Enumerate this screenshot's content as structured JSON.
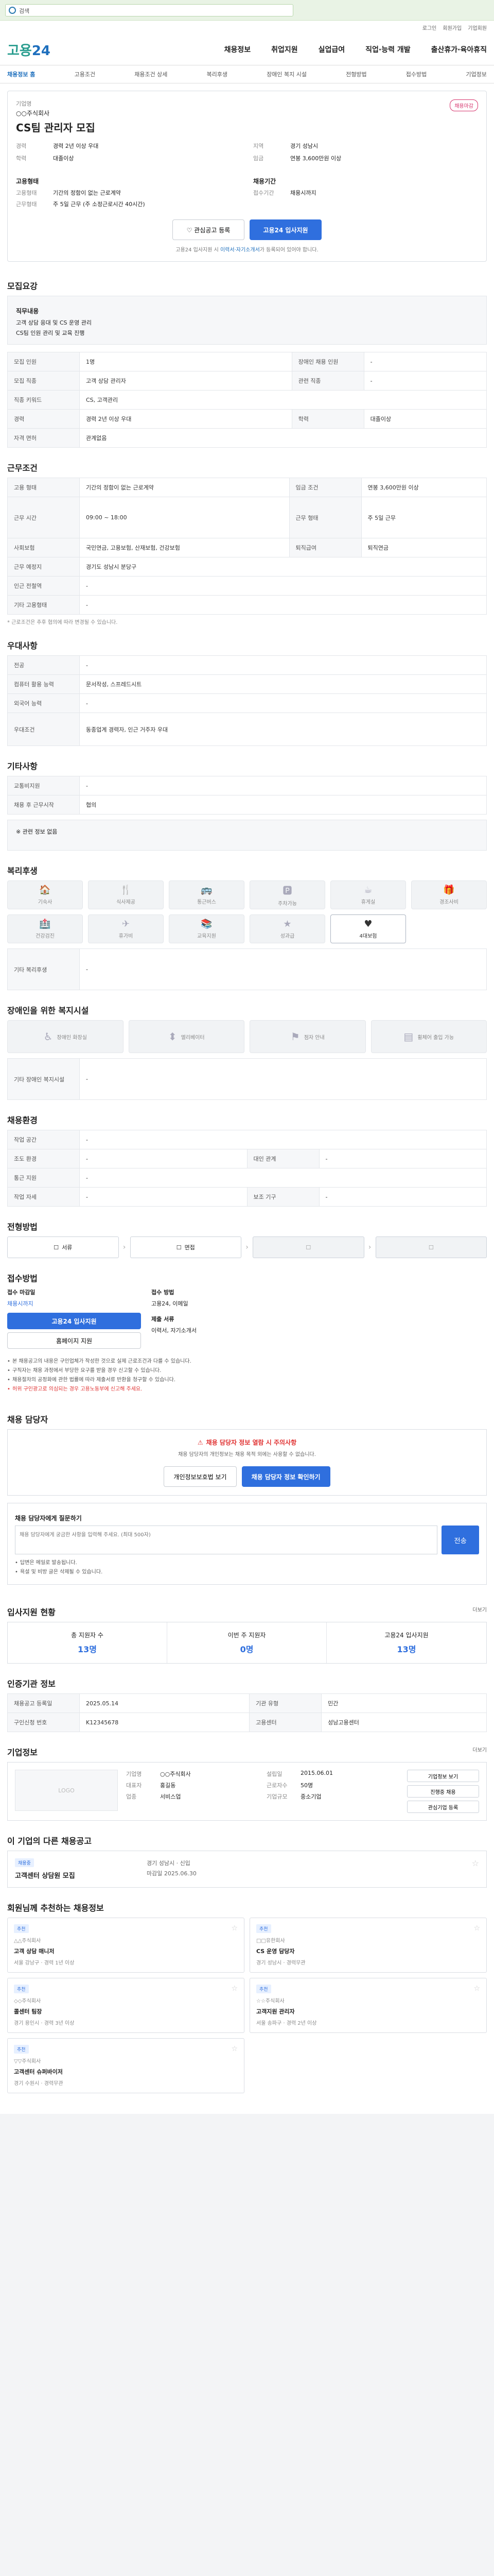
{
  "topbar": {
    "search_label": "검색"
  },
  "util": {
    "login": "로그인",
    "join": "회원가입",
    "corp": "기업회원"
  },
  "header": {
    "logo_a": "고용",
    "logo_b": "24"
  },
  "gnb": [
    {
      "label": "채용정보"
    },
    {
      "label": "취업지원"
    },
    {
      "label": "실업급여"
    },
    {
      "label": "직업·능력 개발"
    },
    {
      "label": "출산휴가·육아휴직"
    }
  ],
  "lnb": [
    "채용정보 홈",
    "고용조건",
    "채용조건 상세",
    "복리후생",
    "장애인 복지 시설",
    "전형방법",
    "접수방법",
    "기업정보"
  ],
  "job": {
    "company_label": "기업명",
    "company": "○○주식회사",
    "title": "CS팀 관리자 모집",
    "badge": "채용마감",
    "info": [
      {
        "k": "경력",
        "v": "경력 2년 이상 우대"
      },
      {
        "k": "지역",
        "v": "경기 성남시"
      },
      {
        "k": "학력",
        "v": "대졸이상"
      },
      {
        "k": "임금",
        "v": "연봉 3,600만원 이상"
      }
    ],
    "cond_title": "고용형태",
    "cond": [
      {
        "k": "고용형태",
        "v": "기간의 정함이 없는 근로계약"
      },
      {
        "k": "근무형태",
        "v": "주 5일 근무 (주 소정근로시간 40시간)"
      }
    ],
    "period_title": "채용기간",
    "period": [
      {
        "k": "접수기간",
        "v": "채용시까지"
      }
    ],
    "btn_save": "관심공고 등록",
    "btn_apply": "고용24 입사지원",
    "note_a": "고용24 입사지원 시 ",
    "note_b": "이력서·자기소개서",
    "note_c": "가 등록되어 있어야 합니다."
  },
  "s1": {
    "title": "모집요강",
    "duty_title": "직무내용",
    "duty": [
      "고객 상담 응대 및 CS 운영 관리",
      "CS팀 인원 관리 및 교육 진행"
    ],
    "rows": [
      {
        "k": "모집 인원",
        "v": "1명",
        "k2": "장애인 채용 인원",
        "v2": "-"
      },
      {
        "k": "모집 직종",
        "v": "고객 상담 관리자",
        "k2": "관련 직종",
        "v2": "-"
      },
      {
        "k": "직종 키워드",
        "v": "CS, 고객관리",
        "k2": "",
        "v2": ""
      },
      {
        "k": "경력",
        "v": "경력 2년 이상 우대",
        "k2": "학력",
        "v2": "대졸이상"
      },
      {
        "k": "자격 면허",
        "v": "관계없음",
        "k2": "",
        "v2": ""
      }
    ]
  },
  "s2": {
    "title": "근무조건",
    "rows": [
      {
        "k": "고용 형태",
        "v": "기간의 정함이 없는 근로계약",
        "k2": "임금 조건",
        "v2": "연봉 3,600만원 이상"
      },
      {
        "k": "근무 시간",
        "v": "09:00 ~ 18:00",
        "k2": "근무 형태",
        "v2": "주 5일 근무"
      },
      {
        "k": "사회보험",
        "v": "국민연금, 고용보험, 산재보험, 건강보험",
        "k2": "퇴직급여",
        "v2": "퇴직연금"
      },
      {
        "k": "근무 예정지",
        "v": "경기도 성남시 분당구",
        "k2": "",
        "v2": ""
      },
      {
        "k": "인근 전철역",
        "v": "-",
        "k2": "",
        "v2": ""
      },
      {
        "k": "기타 고용형태",
        "v": "-",
        "k2": "",
        "v2": ""
      }
    ],
    "note": "* 근로조건은 추후 협의에 따라 변경될 수 있습니다."
  },
  "s3": {
    "title": "우대사항",
    "rows": [
      {
        "k": "전공",
        "v": "-"
      },
      {
        "k": "컴퓨터 활용 능력",
        "v": "문서작성, 스프레드시트"
      },
      {
        "k": "외국어 능력",
        "v": "-"
      },
      {
        "k": "우대조건",
        "v": "동종업계 경력자, 인근 거주자 우대"
      }
    ]
  },
  "s4": {
    "title": "기타사항",
    "rows": [
      {
        "k": "교통비지원",
        "v": "-"
      },
      {
        "k": "채용 후 근무시작",
        "v": "협의"
      }
    ],
    "box": "※ 관련 정보 없음"
  },
  "s5": {
    "title": "복리후생",
    "items": [
      {
        "icon": "🏠",
        "label": "기숙사",
        "on": false
      },
      {
        "icon": "🍴",
        "label": "식사제공",
        "on": false
      },
      {
        "icon": "🚌",
        "label": "통근버스",
        "on": false
      },
      {
        "icon": "🅿",
        "label": "주차가능",
        "on": false
      },
      {
        "icon": "☕",
        "label": "휴게실",
        "on": false
      },
      {
        "icon": "🎁",
        "label": "경조사비",
        "on": false
      },
      {
        "icon": "🏥",
        "label": "건강검진",
        "on": false
      },
      {
        "icon": "✈",
        "label": "휴가비",
        "on": false
      },
      {
        "icon": "📚",
        "label": "교육지원",
        "on": false
      },
      {
        "icon": "★",
        "label": "성과급",
        "on": false
      },
      {
        "icon": "♥",
        "label": "4대보험",
        "on": true
      }
    ],
    "etc_label": "기타 복리후생",
    "etc": "-"
  },
  "s6": {
    "title": "장애인을 위한 복지시설",
    "items": [
      {
        "icon": "♿",
        "label": "장애인 화장실"
      },
      {
        "icon": "⬍",
        "label": "엘리베이터"
      },
      {
        "icon": "⚑",
        "label": "점자 안내"
      },
      {
        "icon": "▤",
        "label": "휠체어 출입 가능"
      }
    ],
    "etc_label": "기타 장애인 복지시설",
    "etc": "-"
  },
  "s7": {
    "title": "채용환경",
    "rows": [
      {
        "k": "작업 공간",
        "v": "-",
        "k2": "",
        "v2": ""
      },
      {
        "k": "조도 환경",
        "v": "-",
        "k2": "대인 관계",
        "v2": "-"
      },
      {
        "k": "통근 지원",
        "v": "-",
        "k2": "",
        "v2": ""
      },
      {
        "k": "작업 자세",
        "v": "-",
        "k2": "보조 기구",
        "v2": "-"
      }
    ]
  },
  "s8": {
    "title": "전형방법",
    "steps": [
      {
        "icon": "☐",
        "label": "서류",
        "off": false
      },
      {
        "icon": "☐",
        "label": "면접",
        "off": false
      },
      {
        "icon": "☐",
        "label": "",
        "off": true
      },
      {
        "icon": "☐",
        "label": "",
        "off": true
      }
    ]
  },
  "s9": {
    "title": "접수방법",
    "lbl_a": "접수 마감일",
    "deadline": "채용시까지",
    "btn_a": "고용24 입사지원",
    "btn_b": "홈페이지 지원",
    "lbl_b": "접수 방법",
    "method": "고용24, 이메일",
    "lbl_c": "제출 서류",
    "docs": "이력서, 자기소개서",
    "notes": [
      "본 채용공고의 내용은 구인업체가 작성한 것으로 실제 근로조건과 다를 수 있습니다.",
      "구직자는 채용 과정에서 부당한 요구를 받을 경우 신고할 수 있습니다.",
      "채용절차의 공정화에 관한 법률에 따라 제출서류 반환을 청구할 수 있습니다."
    ],
    "warn": "허위 구인광고로 의심되는 경우 고용노동부에 신고해 주세요."
  },
  "s10": {
    "title": "채용 담당자",
    "warn": "채용 담당자 정보 열람 시 주의사항",
    "desc": "채용 담당자의 개인정보는 채용 목적 외에는 사용할 수 없습니다.",
    "btn_a": "개인정보보호법 보기",
    "btn_b": "채용 담당자 정보 확인하기"
  },
  "s11": {
    "title": "채용 담당자에게 질문하기",
    "placeholder": "채용 담당자에게 궁금한 사항을 입력해 주세요. (최대 500자)",
    "send": "전송",
    "notes": [
      "답변은 메일로 발송됩니다.",
      "욕설 및 비방 글은 삭제될 수 있습니다."
    ]
  },
  "s12": {
    "title": "입사지원 현황",
    "more": "더보기",
    "stats": [
      {
        "k": "총 지원자 수",
        "v": "13명"
      },
      {
        "k": "이번 주 지원자",
        "v": "0명"
      },
      {
        "k": "고용24 입사지원",
        "v": "13명"
      }
    ]
  },
  "s13": {
    "title": "인증기관 정보",
    "rows": [
      {
        "k": "채용공고 등록일",
        "v": "2025.05.14",
        "k2": "기관 유형",
        "v2": "민간"
      },
      {
        "k": "구인신청 번호",
        "v": "K12345678",
        "k2": "고용센터",
        "v2": "성남고용센터"
      }
    ]
  },
  "s14": {
    "title": "기업정보",
    "more": "더보기",
    "logo": "LOGO",
    "info_a": [
      {
        "k": "기업명",
        "v": "○○주식회사"
      },
      {
        "k": "대표자",
        "v": "홍길동"
      },
      {
        "k": "업종",
        "v": "서비스업"
      }
    ],
    "info_b": [
      {
        "k": "설립일",
        "v": "2015.06.01"
      },
      {
        "k": "근로자수",
        "v": "50명"
      },
      {
        "k": "기업규모",
        "v": "중소기업"
      }
    ],
    "pills": [
      "기업정보 보기",
      "진행중 채용",
      "관심기업 등록"
    ]
  },
  "s15": {
    "title": "이 기업의 다른 채용공고",
    "tag": "채용중",
    "name": "고객센터 상담원 모집",
    "meta_a": "경기 성남시 · 신입",
    "meta_b": "마감일 2025.06.30"
  },
  "s16": {
    "title": "회원님께 추천하는 채용정보",
    "items": [
      {
        "tag": "추천",
        "name": "고객 상담 매니저",
        "co": "△△주식회사",
        "meta": "서울 강남구 · 경력 1년 이상"
      },
      {
        "tag": "추천",
        "name": "CS 운영 담당자",
        "co": "□□유한회사",
        "meta": "경기 성남시 · 경력무관"
      },
      {
        "tag": "추천",
        "name": "콜센터 팀장",
        "co": "◇◇주식회사",
        "meta": "경기 용인시 · 경력 3년 이상"
      },
      {
        "tag": "추천",
        "name": "고객지원 관리자",
        "co": "☆☆주식회사",
        "meta": "서울 송파구 · 경력 2년 이상"
      },
      {
        "tag": "추천",
        "name": "고객센터 슈퍼바이저",
        "co": "▽▽주식회사",
        "meta": "경기 수원시 · 경력무관"
      }
    ]
  }
}
